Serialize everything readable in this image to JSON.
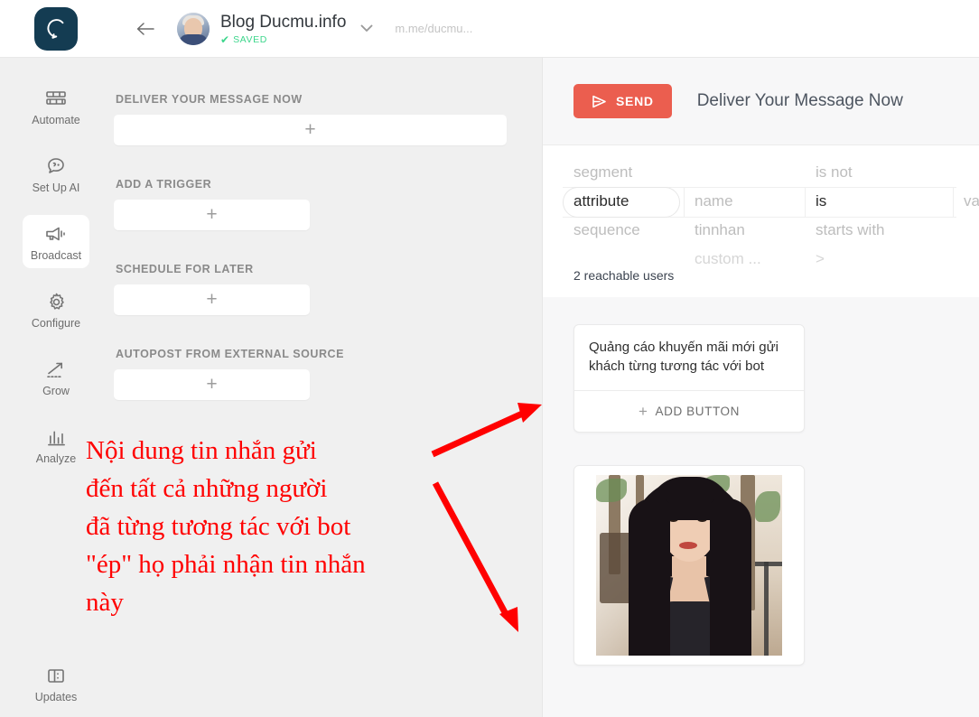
{
  "topbar": {
    "logo_icon": "chat-bubble-logo",
    "back_icon": "back-arrow-icon",
    "avatar_name": "page-avatar",
    "page_title": "Blog Ducmu.info",
    "saved_check": "✔",
    "saved_label": "SAVED",
    "chevron_icon": "chevron-down-icon",
    "mme_url": "m.me/ducmu..."
  },
  "sidebar": {
    "items": [
      {
        "label": "Automate",
        "icon": "automate-icon",
        "active": false
      },
      {
        "label": "Set Up AI",
        "icon": "set-up-ai-icon",
        "active": false
      },
      {
        "label": "Broadcast",
        "icon": "broadcast-megaphone-icon",
        "active": true
      },
      {
        "label": "Configure",
        "icon": "gear-icon",
        "active": false
      },
      {
        "label": "Grow",
        "icon": "growth-arrow-icon",
        "active": false
      },
      {
        "label": "Analyze",
        "icon": "bar-chart-icon",
        "active": false
      }
    ],
    "bottom": {
      "label": "Updates",
      "icon": "updates-icon"
    }
  },
  "middle": {
    "sections": [
      {
        "label": "DELIVER YOUR MESSAGE NOW",
        "add_glyph": "+",
        "width": "wide"
      },
      {
        "label": "ADD A TRIGGER",
        "add_glyph": "+",
        "width": "narrow"
      },
      {
        "label": "SCHEDULE FOR LATER",
        "add_glyph": "+",
        "width": "narrow"
      },
      {
        "label": "AUTOPOST FROM EXTERNAL SOURCE",
        "add_glyph": "+",
        "width": "narrow"
      }
    ]
  },
  "annotation": {
    "text": "Nội dung tin nhắn gửi\nđến tất cả những người\nđã từng tương tác với bot\n\"ép\" họ phải nhận tin nhắn\nnày",
    "color": "#ff0000",
    "arrow_count": 2
  },
  "right": {
    "send_button": {
      "label": "SEND",
      "icon": "send-paper-plane-icon",
      "color": "#eb5e4f"
    },
    "header_title": "Deliver Your Message Now",
    "filter": {
      "columns": [
        {
          "name": "type-column",
          "options": [
            "segment",
            "attribute",
            "sequence",
            ""
          ]
        },
        {
          "name": "field-column",
          "options": [
            "",
            "name",
            "tinnhan",
            "custom ..."
          ]
        },
        {
          "name": "operator-column",
          "options": [
            "is not",
            "is",
            "starts with",
            ">"
          ]
        },
        {
          "name": "value-column",
          "options": [
            "",
            "value",
            "",
            ""
          ]
        }
      ],
      "selected_index": 1
    },
    "reachable": "2 reachable users",
    "message_card": {
      "text": "Quảng cáo khuyến mãi mới gửi khách từng tương tác với bot",
      "add_button_label": "ADD BUTTON",
      "add_button_glyph": "+"
    },
    "image_card": {
      "alt": "broadcast-photo"
    }
  }
}
